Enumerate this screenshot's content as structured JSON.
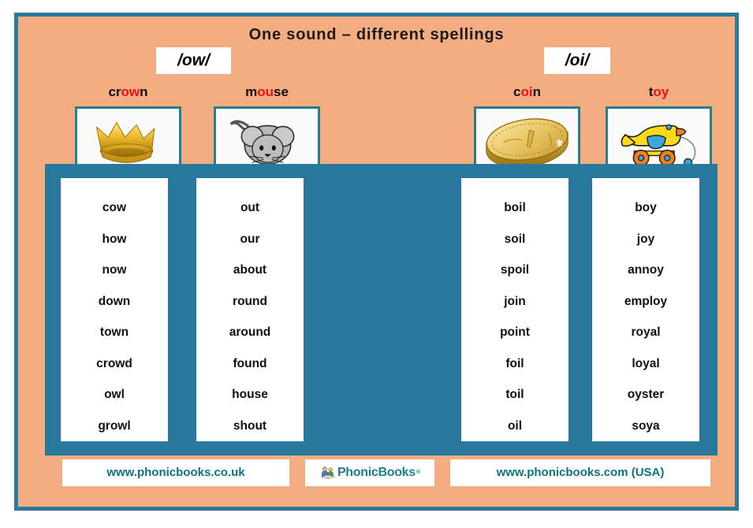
{
  "poster": {
    "title": "One sound – different spellings",
    "background_color": "#f3ad80",
    "border_color": "#2c7a99",
    "panel_color": "#27789c",
    "highlight_color": "#ee1111",
    "link_color": "#0c7382"
  },
  "phonemes": [
    {
      "label": "/ow/"
    },
    {
      "label": "/oi/"
    }
  ],
  "headings": [
    {
      "pre": "cr",
      "hl": "ow",
      "post": "n",
      "full": "crown",
      "picture": "crown-image"
    },
    {
      "pre": "m",
      "hl": "ou",
      "post": "se",
      "full": "mouse",
      "picture": "mouse-image"
    },
    {
      "pre": "c",
      "hl": "oi",
      "post": "n",
      "full": "coin",
      "picture": "coin-image"
    },
    {
      "pre": "t",
      "hl": "oy",
      "post": "",
      "full": "toy",
      "picture": "toy-image"
    }
  ],
  "columns": [
    {
      "grapheme": "ow",
      "words": [
        "cow",
        "how",
        "now",
        "down",
        "town",
        "crowd",
        "owl",
        "growl"
      ]
    },
    {
      "grapheme": "ou",
      "words": [
        "out",
        "our",
        "about",
        "round",
        "around",
        "found",
        "house",
        "shout"
      ]
    },
    {
      "grapheme": "oi",
      "words": [
        "boil",
        "soil",
        "spoil",
        "join",
        "point",
        "foil",
        "toil",
        "oil"
      ]
    },
    {
      "grapheme": "oy",
      "words": [
        "boy",
        "joy",
        "annoy",
        "employ",
        "royal",
        "loyal",
        "oyster",
        "soya"
      ]
    }
  ],
  "footer": {
    "uk_site": "www.phonicbooks.co.uk",
    "logo_text": "PhonicBooks",
    "logo_reg": "®",
    "usa_site": "www.phonicbooks.com  (USA)"
  }
}
